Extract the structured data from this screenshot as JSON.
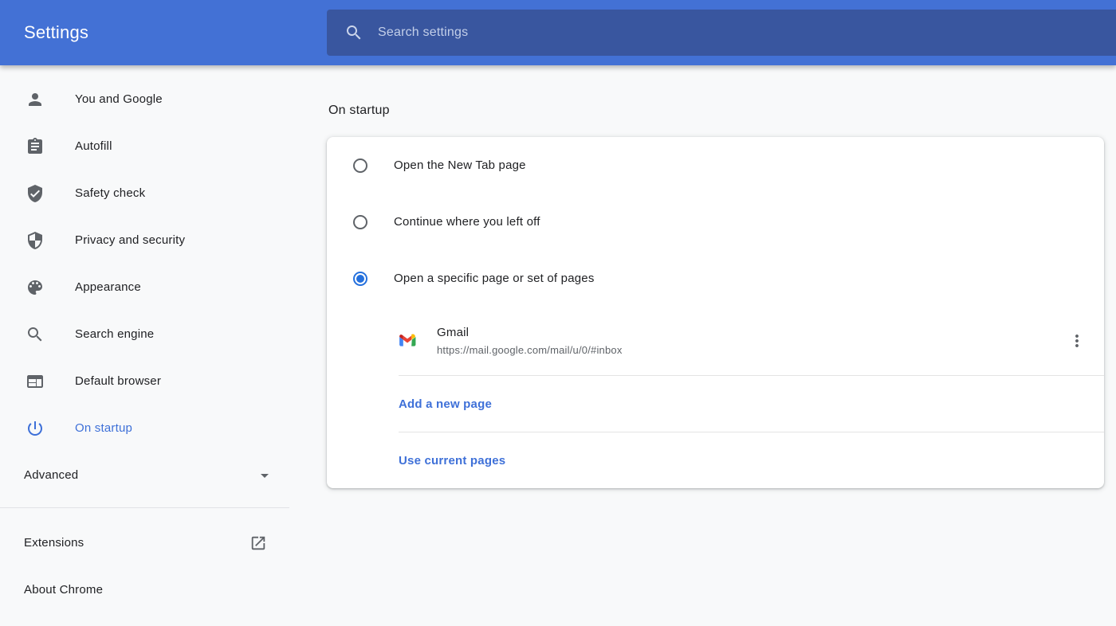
{
  "header": {
    "title": "Settings",
    "search_placeholder": "Search settings"
  },
  "sidebar": {
    "items": [
      {
        "label": "You and Google",
        "icon": "person-icon",
        "selected": false
      },
      {
        "label": "Autofill",
        "icon": "clipboard-icon",
        "selected": false
      },
      {
        "label": "Safety check",
        "icon": "shield-check-icon",
        "selected": false
      },
      {
        "label": "Privacy and security",
        "icon": "shield-half-icon",
        "selected": false
      },
      {
        "label": "Appearance",
        "icon": "palette-icon",
        "selected": false
      },
      {
        "label": "Search engine",
        "icon": "magnifier-icon",
        "selected": false
      },
      {
        "label": "Default browser",
        "icon": "browser-window-icon",
        "selected": false
      },
      {
        "label": "On startup",
        "icon": "power-icon",
        "selected": true
      }
    ],
    "advanced_label": "Advanced",
    "extensions_label": "Extensions",
    "about_label": "About Chrome"
  },
  "main": {
    "heading": "On startup",
    "options": [
      {
        "label": "Open the New Tab page",
        "selected": false
      },
      {
        "label": "Continue where you left off",
        "selected": false
      },
      {
        "label": "Open a specific page or set of pages",
        "selected": true
      }
    ],
    "startup_page": {
      "title": "Gmail",
      "url": "https://mail.google.com/mail/u/0/#inbox"
    },
    "add_page_label": "Add a new page",
    "use_current_label": "Use current pages"
  },
  "colors": {
    "header_bg": "#4371d5",
    "search_bg": "#39569f",
    "accent_blue": "#3e70d8",
    "radio_blue": "#2470dd",
    "text_primary": "#202124",
    "text_secondary": "#5f6368",
    "page_bg": "#f8f9fa"
  }
}
